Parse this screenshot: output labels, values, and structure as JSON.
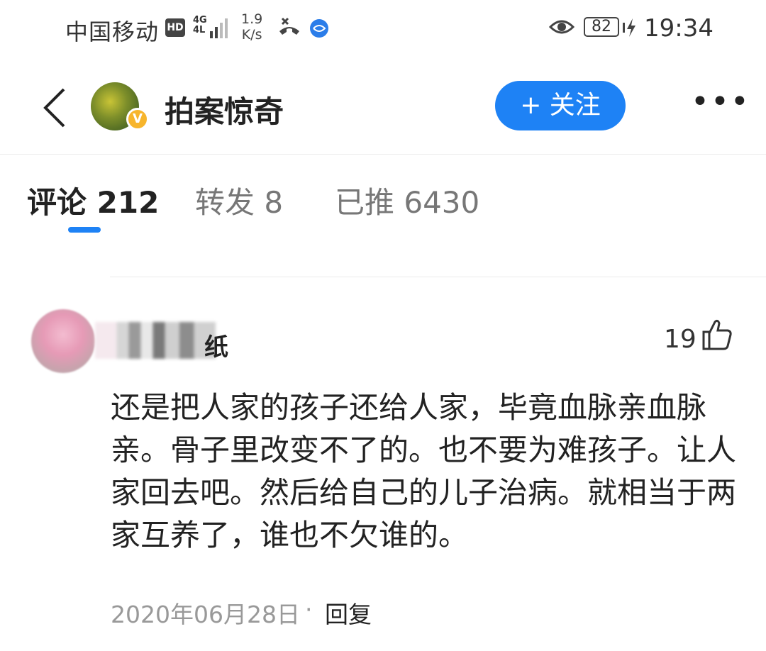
{
  "status_bar": {
    "carrier": "中国移动",
    "hd": "HD",
    "network": "4G",
    "network_sub": "4L",
    "speed_value": "1.9",
    "speed_unit": "K/s",
    "battery": "82",
    "time": "19:34"
  },
  "header": {
    "channel_name": "拍案惊奇",
    "verified_mark": "V",
    "follow_label": "+ 关注",
    "more_label": "•••"
  },
  "tabs": [
    {
      "label": "评论 212",
      "active": true
    },
    {
      "label": "转发 8",
      "active": false
    },
    {
      "label": "已推 6430",
      "active": false
    }
  ],
  "comment": {
    "username_visible_tail": "纸",
    "likes": "19",
    "text": "还是把人家的孩子还给人家，毕竟血脉亲血脉亲。骨子里改变不了的。也不要为难孩子。让人家回去吧。然后给自己的儿子治病。就相当于两家互养了，谁也不欠谁的。",
    "date": "2020年06月28日",
    "separator": "·",
    "reply_label": "回复"
  },
  "colors": {
    "accent": "#1e82f5",
    "verified_badge": "#f7b52c"
  }
}
